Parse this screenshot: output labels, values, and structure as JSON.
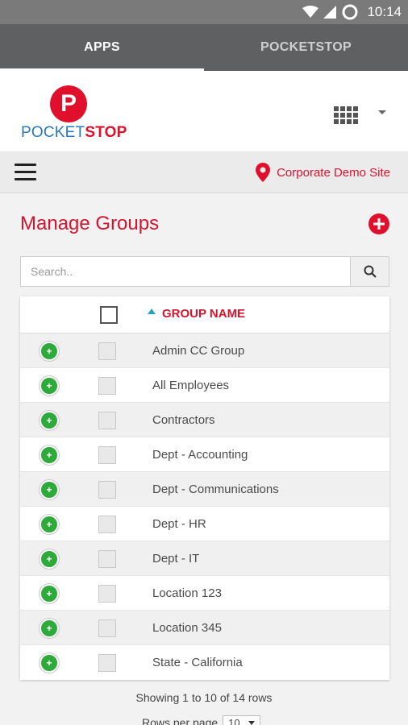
{
  "status_bar": {
    "time": "10:14"
  },
  "tabs": [
    {
      "label": "APPS",
      "active": true
    },
    {
      "label": "POCKETSTOP",
      "active": false
    }
  ],
  "header": {
    "logo_mark": "P",
    "logo_text_pocket": "POCKET",
    "logo_text_stop": "STOP"
  },
  "nav": {
    "site_label": "Corporate Demo Site"
  },
  "page": {
    "title": "Manage Groups"
  },
  "search": {
    "placeholder": "Search.."
  },
  "table": {
    "column_header": "GROUP NAME",
    "rows": [
      "Admin CC Group",
      "All Employees",
      "Contractors",
      "Dept - Accounting",
      "Dept - Communications",
      "Dept - HR",
      "Dept - IT",
      "Location 123",
      "Location 345",
      "State - California"
    ]
  },
  "pagination": {
    "summary": "Showing 1 to 10 of 14 rows",
    "rows_per_page_label": "Rows per page",
    "rows_per_page_value": "10"
  },
  "colors": {
    "brand_red": "#e0102d",
    "brand_blue": "#2a78b8",
    "expand_green": "#2eaa3a",
    "sort_teal": "#26a4b6"
  }
}
